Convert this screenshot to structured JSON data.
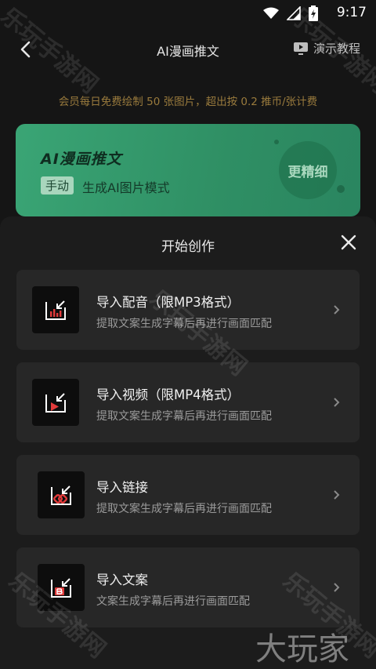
{
  "status_bar": {
    "time": "9:17"
  },
  "header": {
    "title": "AI漫画推文",
    "demo_label": "演示教程"
  },
  "notice": "会员每日免费绘制 50 张图片，超出按 0.2 推币/张计费",
  "banner": {
    "title": "AI漫画推文",
    "tag": "手动",
    "description": "生成AI图片模式",
    "badge": "更精细"
  },
  "sheet": {
    "title": "开始创作",
    "items": [
      {
        "title": "导入配音（限MP3格式）",
        "subtitle": "提取文案生成字幕后再进行画面匹配",
        "icon": "audio-import-icon"
      },
      {
        "title": "导入视频（限MP4格式）",
        "subtitle": "提取文案生成字幕后再进行画面匹配",
        "icon": "video-import-icon"
      },
      {
        "title": "导入链接",
        "subtitle": "提取文案生成字幕后再进行画面匹配",
        "icon": "link-import-icon"
      },
      {
        "title": "导入文案",
        "subtitle": "文案生成字幕后再进行画面匹配",
        "icon": "text-import-icon"
      }
    ]
  },
  "watermarks": {
    "site": "乐玩手游网",
    "brand": "大玩家"
  },
  "colors": {
    "accent_green": "#3aa575",
    "notice_gold": "#9a7b3d",
    "icon_red": "#e23b3b",
    "background": "#151515",
    "card": "#272727"
  }
}
